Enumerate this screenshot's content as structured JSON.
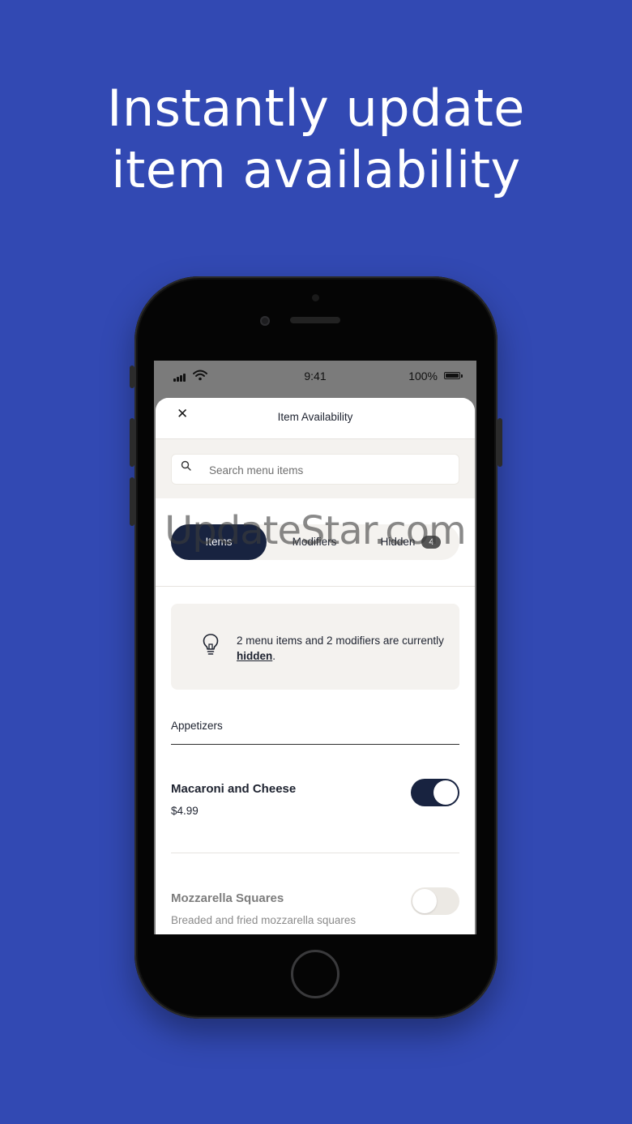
{
  "headline": {
    "line1": "Instantly update",
    "line2": "item availability"
  },
  "status_bar": {
    "time": "9:41",
    "battery": "100%"
  },
  "sheet": {
    "title": "Item Availability",
    "close_icon": "close-icon",
    "search": {
      "placeholder": "Search menu items",
      "value": ""
    },
    "tabs": [
      {
        "label": "Items",
        "active": true
      },
      {
        "label": "Modifiers",
        "active": false
      },
      {
        "label": "Hidden",
        "active": false,
        "badge": "4"
      }
    ],
    "notice": {
      "icon": "lightbulb-icon",
      "text_before": "2 menu items and 2 modifiers are currently ",
      "link": "hidden",
      "text_after": "."
    },
    "section": {
      "title": "Appetizers",
      "items": [
        {
          "name": "Macaroni and Cheese",
          "price": "$4.99",
          "available": true
        },
        {
          "name": "Mozzarella Squares",
          "description": "Breaded and fried mozzarella squares",
          "available": false
        }
      ]
    }
  },
  "watermark": "UpdateStar.com",
  "colors": {
    "background": "#3249b3",
    "accent_dark": "#182340",
    "surface": "#f4f2ef"
  }
}
